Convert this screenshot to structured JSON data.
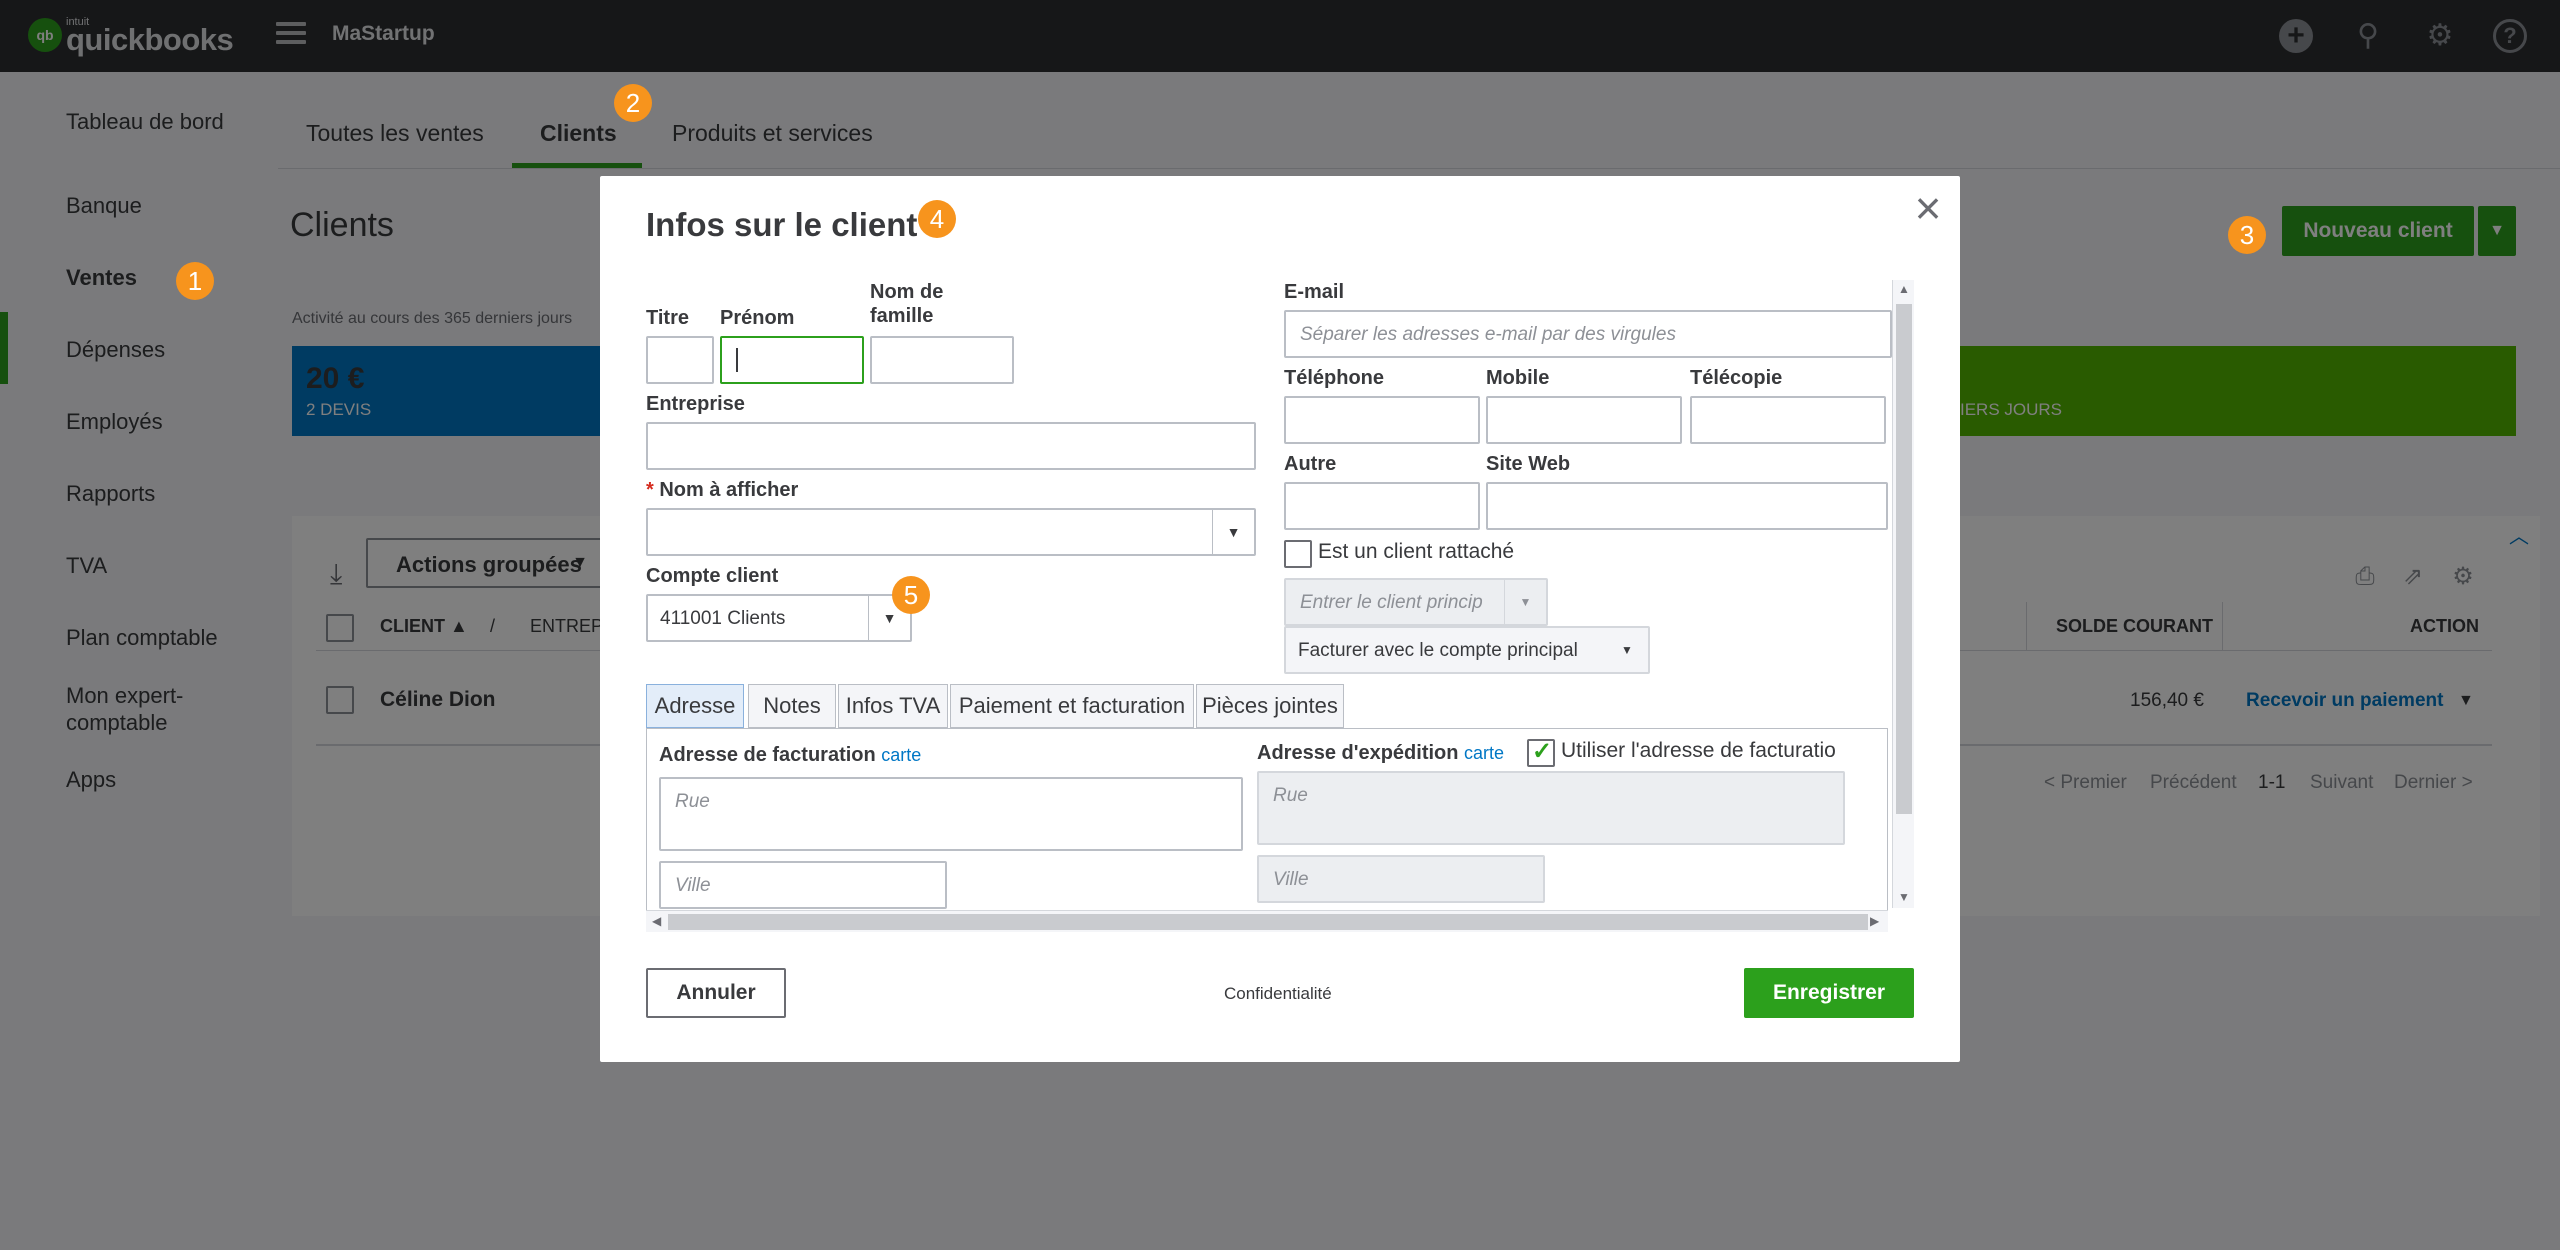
{
  "topbar": {
    "logo_small": "intuit",
    "logo_big": "quickbooks",
    "logo_mark": "qb",
    "company": "MaStartup",
    "icons": [
      "plus-icon",
      "search-icon",
      "gear-icon",
      "help-icon"
    ]
  },
  "sidebar": {
    "items": [
      {
        "label": "Tableau de bord"
      },
      {
        "label": "Banque"
      },
      {
        "label": "Ventes"
      },
      {
        "label": "Dépenses"
      },
      {
        "label": "Employés"
      },
      {
        "label": "Rapports"
      },
      {
        "label": "TVA"
      },
      {
        "label": "Plan comptable"
      },
      {
        "label": "Mon expert-comptable"
      },
      {
        "label": "Apps"
      }
    ],
    "active": "Ventes"
  },
  "tabs": [
    {
      "label": "Toutes les ventes"
    },
    {
      "label": "Clients"
    },
    {
      "label": "Produits et services"
    }
  ],
  "page": {
    "title": "Clients",
    "activity": "Activité au cours des 365 derniers jours",
    "tile_blue_value": "20 €",
    "tile_blue_label": "2 DEVIS",
    "tile_green_label": "IERS JOURS",
    "new_client": "Nouveau client"
  },
  "table": {
    "batch": "Actions groupées",
    "headers": [
      "CLIENT ▲",
      "/",
      "ENTREP",
      "SOLDE COURANT",
      "ACTION"
    ],
    "rows": [
      {
        "name": "Céline Dion",
        "balance": "156,40 €",
        "action": "Recevoir un paiement"
      }
    ],
    "pager": {
      "first": "< Premier",
      "prev": "Précédent",
      "range": "1-1",
      "next": "Suivant",
      "last": "Dernier >"
    }
  },
  "callouts": [
    "1",
    "2",
    "3",
    "4",
    "5"
  ],
  "modal": {
    "title": "Infos sur le client",
    "labels": {
      "titre": "Titre",
      "prenom": "Prénom",
      "nom": "Nom de famille",
      "entreprise": "Entreprise",
      "nom_afficher": "Nom à afficher",
      "required_mark": "*",
      "compte": "Compte client",
      "email": "E-mail",
      "telephone": "Téléphone",
      "mobile": "Mobile",
      "telecopie": "Télécopie",
      "autre": "Autre",
      "site": "Site Web"
    },
    "email_placeholder": "Séparer les adresses e-mail par des virgules",
    "compte_value": "411001 Clients",
    "sub_client_label": "Est un client rattaché",
    "parent_placeholder": "Entrer le client princip",
    "bill_with": "Facturer avec le compte principal",
    "tabs": [
      "Adresse",
      "Notes",
      "Infos TVA",
      "Paiement et facturation",
      "Pièces jointes"
    ],
    "billing_address": "Adresse de facturation",
    "shipping_address": "Adresse d'expédition",
    "map_link": "carte",
    "same_address": "Utiliser l'adresse de facturatio",
    "rue_placeholder": "Rue",
    "ville_placeholder": "Ville",
    "cancel": "Annuler",
    "privacy": "Confidentialité",
    "save": "Enregistrer"
  }
}
